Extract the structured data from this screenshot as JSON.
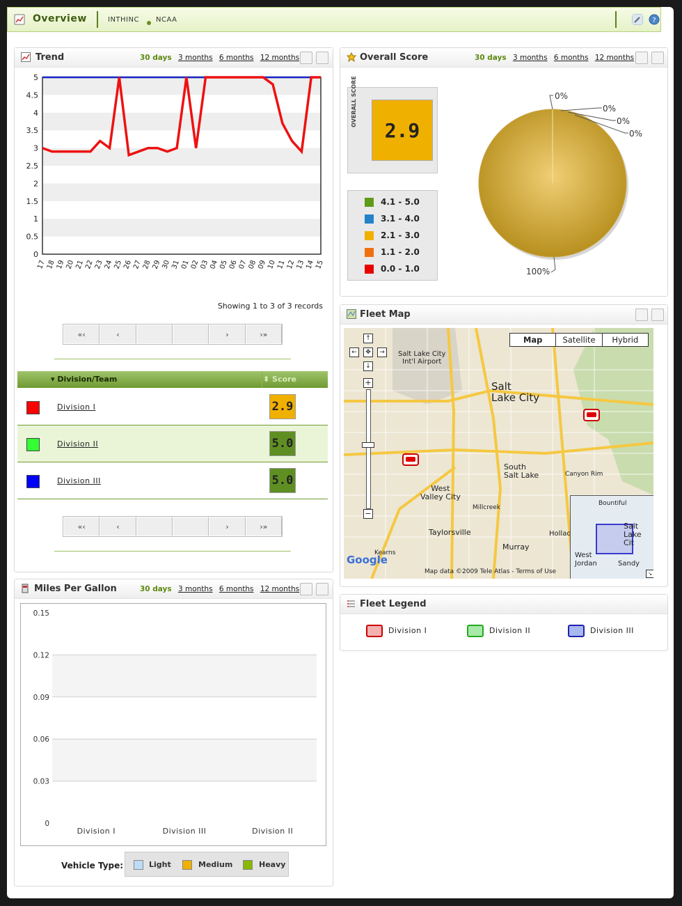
{
  "header": {
    "title": "Overview",
    "crumbs": [
      "INTHINC",
      "NCAA"
    ]
  },
  "ranges": [
    "30 days",
    "3 months",
    "6 months",
    "12 months"
  ],
  "trend": {
    "title": "Trend",
    "records_info": "Showing 1 to 3 of 3 records"
  },
  "pager": {
    "first": "«‹",
    "prev": "‹",
    "next": "›",
    "last": "›»"
  },
  "divisions": {
    "col_name": "Division/Team",
    "col_score": "Score",
    "rows": [
      {
        "name": "Division I",
        "score": "2.9",
        "color": "#ff0000"
      },
      {
        "name": "Division II",
        "score": "5.0",
        "color": "#33ff33"
      },
      {
        "name": "Division III",
        "score": "5.0",
        "color": "#0000ff"
      }
    ]
  },
  "overall": {
    "title": "Overall Score",
    "label": "OVERALL SCORE",
    "value": "2.9",
    "legend": [
      "4.1 - 5.0",
      "3.1 - 4.0",
      "2.1 - 3.0",
      "1.1 - 2.0",
      "0.0 - 1.0"
    ]
  },
  "map": {
    "title": "Fleet Map",
    "types": [
      "Map",
      "Satellite",
      "Hybrid"
    ],
    "labels": [
      "Salt Lake City",
      "Int'l Airport",
      "Salt",
      "Lake City",
      "South",
      "Salt Lake",
      "West",
      "Valley City",
      "Taylorsville",
      "Murray",
      "Canyon Rim",
      "Millcreek",
      "Holladay",
      "Kearns"
    ],
    "minimap_labels": [
      "Bountiful",
      "Salt",
      "Lake Cit",
      "West",
      "Jordan",
      "Sandy"
    ],
    "logo": "Google",
    "attribution": "Map data ©2009 Tele Atlas - Terms of Use"
  },
  "fleet_legend": {
    "title": "Fleet Legend",
    "items": [
      "Division I",
      "Division II",
      "Division III"
    ]
  },
  "mpg": {
    "title": "Miles Per Gallon",
    "vehicle_type_label": "Vehicle Type:",
    "vehicle_types": [
      "Light",
      "Medium",
      "Heavy"
    ]
  },
  "chart_data": [
    {
      "type": "line",
      "name": "trend",
      "x": [
        "17",
        "18",
        "19",
        "20",
        "21",
        "22",
        "23",
        "24",
        "25",
        "26",
        "27",
        "28",
        "29",
        "30",
        "31",
        "01",
        "02",
        "03",
        "04",
        "05",
        "06",
        "07",
        "08",
        "09",
        "10",
        "11",
        "12",
        "13",
        "14",
        "15"
      ],
      "ylim": [
        0,
        5
      ],
      "yticks": [
        0,
        0.5,
        1,
        1.5,
        2,
        2.5,
        3,
        3.5,
        4,
        4.5,
        5
      ],
      "series": [
        {
          "color": "#ee1111",
          "values": [
            3.0,
            2.9,
            2.9,
            2.9,
            2.9,
            2.9,
            3.2,
            3.0,
            5.0,
            2.8,
            2.9,
            3.0,
            3.0,
            2.9,
            3.0,
            5.0,
            3.0,
            5.0,
            5.0,
            5.0,
            5.0,
            5.0,
            5.0,
            5.0,
            4.8,
            3.7,
            3.2,
            2.9,
            5.0,
            5.0
          ]
        },
        {
          "color": "#22ee22",
          "values": [
            5,
            5,
            5,
            5,
            5,
            5,
            5,
            5,
            5,
            5,
            5,
            5,
            5,
            5,
            5,
            5,
            5,
            5,
            5,
            5,
            5,
            5,
            5,
            5,
            5,
            5,
            5,
            5,
            5,
            5
          ]
        },
        {
          "color": "#2222cc",
          "values": [
            5,
            5,
            5,
            5,
            5,
            5,
            5,
            5,
            5,
            5,
            5,
            5,
            5,
            5,
            5,
            5,
            5,
            5,
            5,
            5,
            5,
            5,
            5,
            5,
            5,
            5,
            5,
            5,
            5,
            5
          ]
        }
      ]
    },
    {
      "type": "pie",
      "name": "overall-score",
      "labels": [
        "0%",
        "0%",
        "0%",
        "0%",
        "100%"
      ],
      "values": [
        0,
        0,
        0,
        0,
        100
      ],
      "colors": [
        "#5f9a1a",
        "#2382c8",
        "#f07010",
        "#e80000",
        "#d4a830"
      ]
    },
    {
      "type": "bar",
      "name": "mpg",
      "categories": [
        "Division I",
        "Division III",
        "Division II"
      ],
      "ylim": [
        0,
        0.15
      ],
      "yticks": [
        "0",
        "0.03",
        "0.06",
        "0.09",
        "0.12",
        "0.15"
      ],
      "series": [
        {
          "name": "Light",
          "values": [
            0,
            0,
            0
          ]
        },
        {
          "name": "Medium",
          "values": [
            0,
            0,
            0
          ]
        },
        {
          "name": "Heavy",
          "values": [
            0,
            0,
            0
          ]
        }
      ]
    }
  ]
}
